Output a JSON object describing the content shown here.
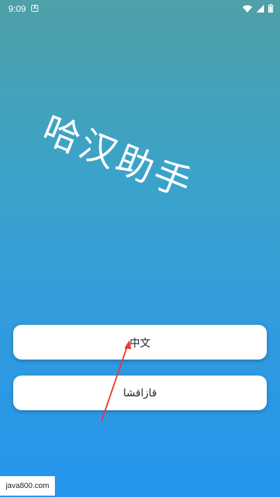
{
  "status_bar": {
    "time": "9:09",
    "notification_letter": "A",
    "icons": [
      "wifi-icon",
      "signal-icon",
      "battery-icon"
    ]
  },
  "app": {
    "title": "哈汉助手"
  },
  "language_buttons": [
    {
      "label": "中文"
    },
    {
      "label": "قازاقشا"
    }
  ],
  "watermark": "java800.com",
  "colors": {
    "gradient_top": "#4fa0a8",
    "gradient_bottom": "#2596ee",
    "button_bg": "#ffffff",
    "arrow": "#e53935"
  }
}
